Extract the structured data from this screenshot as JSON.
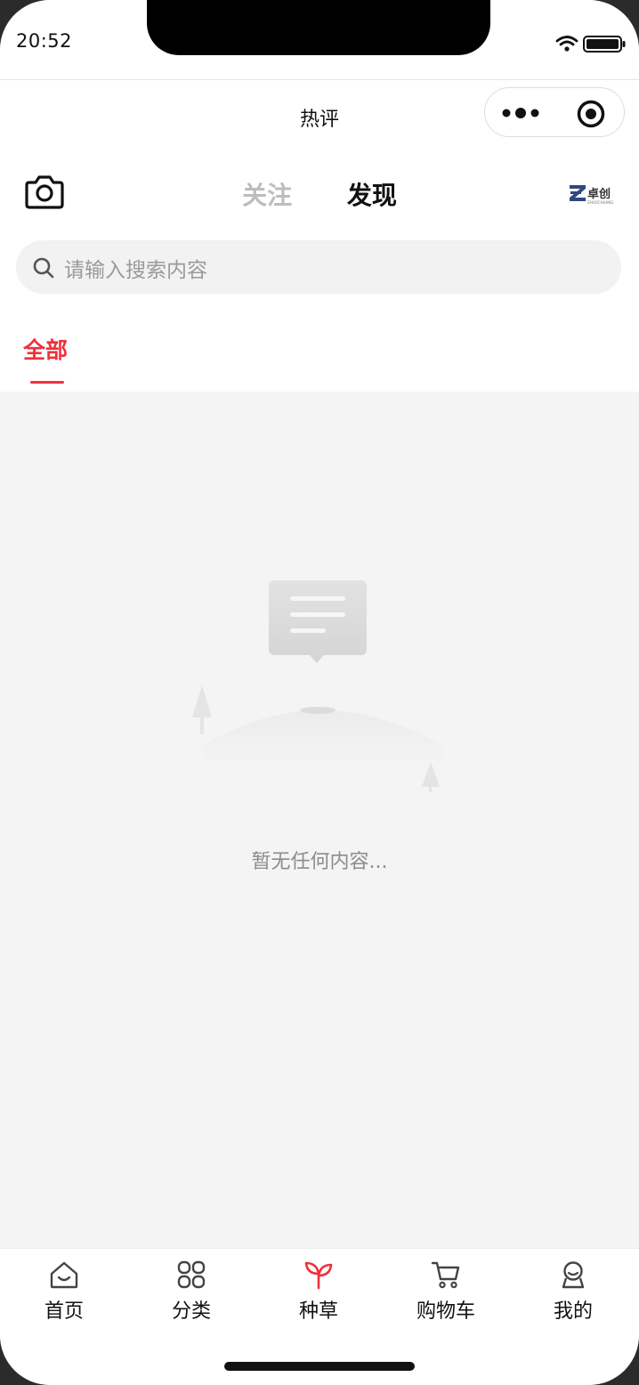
{
  "status_bar": {
    "time": "20:52",
    "icons": [
      "wifi-icon",
      "battery-icon"
    ]
  },
  "navbar": {
    "title": "热评",
    "capsule": [
      "more-icon",
      "target-icon"
    ]
  },
  "header": {
    "camera_icon": "camera-icon",
    "tabs": [
      {
        "label": "关注",
        "active": false
      },
      {
        "label": "发现",
        "active": true
      }
    ],
    "brand_logo": "卓创",
    "brand_logo_sub": "ZHUOCHUANG"
  },
  "search": {
    "placeholder": "请输入搜索内容"
  },
  "category": {
    "active_label": "全部",
    "accent_color": "#f0303a"
  },
  "empty_state": {
    "icon": "empty-comment-illustration",
    "message": "暂无任何内容..."
  },
  "tabbar": {
    "items": [
      {
        "label": "首页",
        "icon": "home-icon",
        "active": false
      },
      {
        "label": "分类",
        "icon": "grid-icon",
        "active": false
      },
      {
        "label": "种草",
        "icon": "sprout-icon",
        "active": true
      },
      {
        "label": "购物车",
        "icon": "cart-icon",
        "active": false
      },
      {
        "label": "我的",
        "icon": "profile-icon",
        "active": false
      }
    ]
  }
}
